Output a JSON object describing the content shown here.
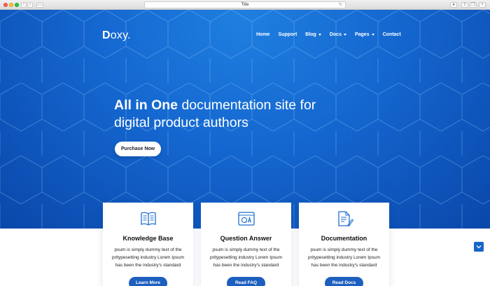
{
  "browser": {
    "tab_title": "Title"
  },
  "brand": {
    "logo_first": "D",
    "logo_rest": "oxy."
  },
  "nav": {
    "items": [
      {
        "label": "Home",
        "dropdown": false
      },
      {
        "label": "Support",
        "dropdown": false
      },
      {
        "label": "Blog",
        "dropdown": true
      },
      {
        "label": "Docs",
        "dropdown": true
      },
      {
        "label": "Pages",
        "dropdown": true
      },
      {
        "label": "Contact",
        "dropdown": false
      }
    ]
  },
  "hero": {
    "headline_strong": "All in One",
    "headline_light": "documentation site for",
    "headline_line2": "digital product authors",
    "cta_label": "Purchase Now"
  },
  "cards": [
    {
      "icon": "book-icon",
      "title": "Knowledge Base",
      "text": "psum is simply dummy text of the pritypesetting industry Lorem Ipsum has been the industry's standard",
      "button": "Learn More"
    },
    {
      "icon": "qa-icon",
      "title": "Question Answer",
      "text": "psum is simply dummy text of the pritypesetting industry Lorem Ipsum has been the industry's standard",
      "button": "Read FAQ"
    },
    {
      "icon": "document-icon",
      "title": "Documentation",
      "text": "psum is simply dummy text of the pritypesetting industry Lorem Ipsum has been the industry's standard",
      "button": "Read Docs"
    }
  ],
  "colors": {
    "hero_blue": "#1466cf",
    "button_blue": "#1d5fbf",
    "icon_blue": "#1f6fce"
  }
}
